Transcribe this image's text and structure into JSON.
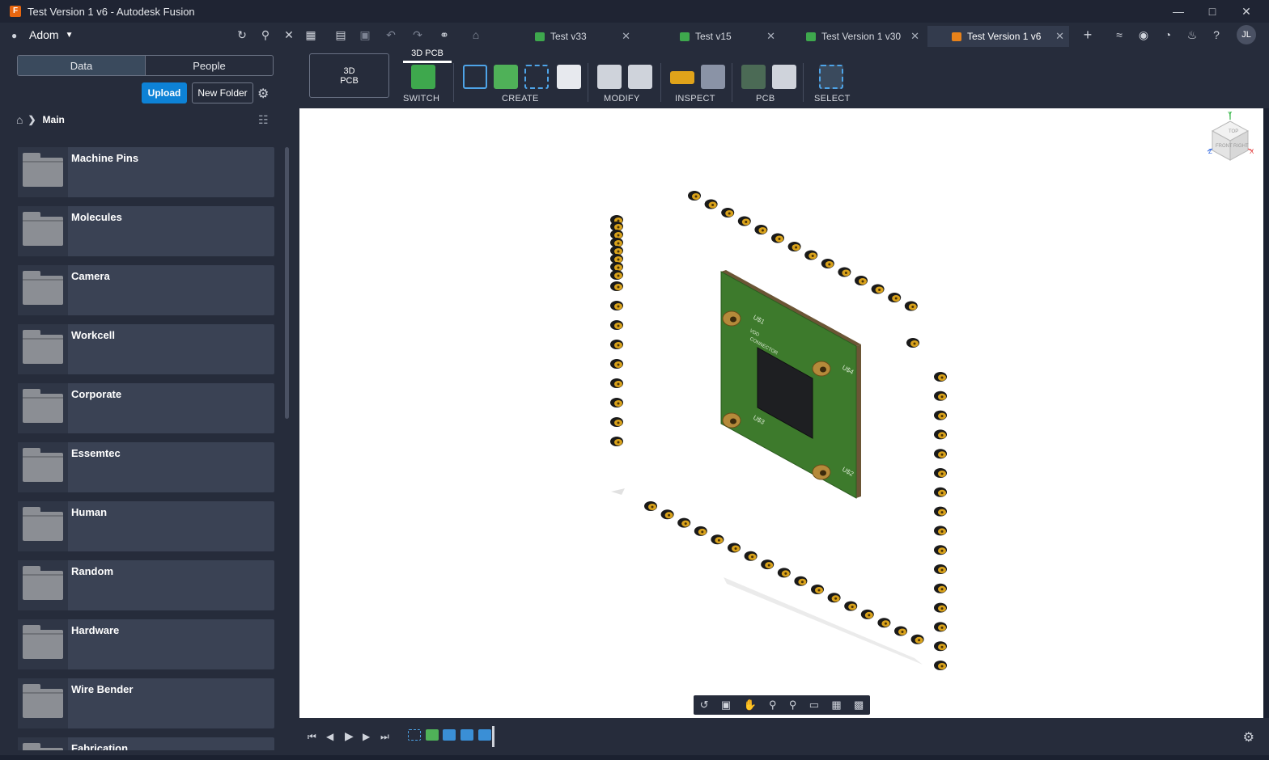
{
  "window": {
    "title": "Test Version 1 v6 - Autodesk Fusion",
    "app_icon_letter": "F"
  },
  "topbar": {
    "account_name": "Adom",
    "user_initials": "JL"
  },
  "tabs": [
    {
      "label": "Test v33",
      "active": false
    },
    {
      "label": "Test v15",
      "active": false
    },
    {
      "label": "Test Version 1 v30",
      "active": false
    },
    {
      "label": "Test Version 1 v6",
      "active": true
    }
  ],
  "left_panel": {
    "segments": {
      "data": "Data",
      "people": "People"
    },
    "upload_label": "Upload",
    "new_folder_label": "New Folder",
    "breadcrumb": "Main",
    "folders": [
      "Machine Pins",
      "Molecules",
      "Camera",
      "Workcell",
      "Corporate",
      "Essemtec",
      "Human",
      "Random",
      "Hardware",
      "Wire Bender",
      "Fabrication"
    ]
  },
  "ribbon": {
    "workspace_line1": "3D",
    "workspace_line2": "PCB",
    "active_tab": "3D PCB",
    "groups": {
      "switch": "SWITCH",
      "create": "CREATE",
      "modify": "MODIFY",
      "inspect": "INSPECT",
      "pcb": "PCB",
      "select": "SELECT"
    }
  },
  "viewcube": {
    "top": "TOP",
    "front": "FRONT",
    "right": "RIGHT",
    "axis_x": "X",
    "axis_y": "Y",
    "axis_z": "Z"
  },
  "board": {
    "labels": [
      "U$1",
      "U$4",
      "U$3",
      "U$2",
      "VDD",
      "CONNECTOR"
    ]
  },
  "colors": {
    "accent_upload": "#0d82d6",
    "pcb_green": "#3d7a2c",
    "pin_gold": "#d9a21b",
    "viewport_bg": "#ffffff",
    "chrome_bg": "#262c3b"
  }
}
